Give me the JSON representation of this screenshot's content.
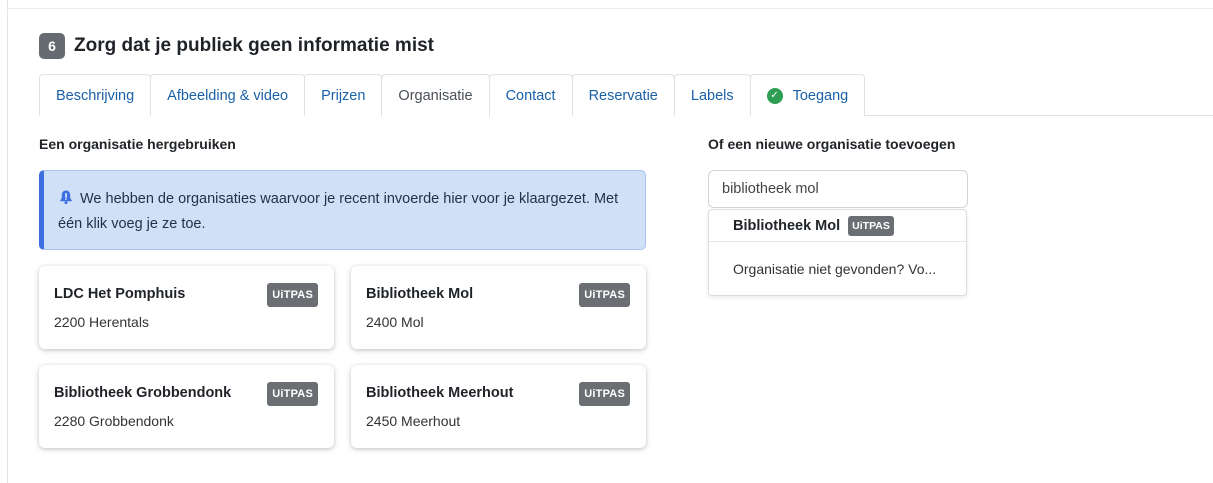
{
  "step": {
    "number": "6",
    "title": "Zorg dat je publiek geen informatie mist"
  },
  "tabs": [
    {
      "label": "Beschrijving"
    },
    {
      "label": "Afbeelding & video"
    },
    {
      "label": "Prijzen"
    },
    {
      "label": "Organisatie"
    },
    {
      "label": "Contact"
    },
    {
      "label": "Reservatie"
    },
    {
      "label": "Labels"
    },
    {
      "label": "Toegang"
    }
  ],
  "reuse": {
    "heading": "Een organisatie hergebruiken",
    "alert_text": "We hebben de organisaties waarvoor je recent invoerde hier voor je klaargezet. Met één klik voeg je ze toe.",
    "cards": [
      {
        "name": "LDC Het Pomphuis",
        "location": "2200 Herentals",
        "badge": "UiTPAS"
      },
      {
        "name": "Bibliotheek Mol",
        "location": "2400 Mol",
        "badge": "UiTPAS"
      },
      {
        "name": "Bibliotheek Grobbendonk",
        "location": "2280 Grobbendonk",
        "badge": "UiTPAS"
      },
      {
        "name": "Bibliotheek Meerhout",
        "location": "2450 Meerhout",
        "badge": "UiTPAS"
      }
    ]
  },
  "new_org": {
    "heading": "Of een nieuwe organisatie toevoegen",
    "search_value": "bibliotheek mol",
    "suggestions": [
      {
        "name": "Bibliotheek Mol",
        "badge": "UiTPAS"
      },
      {
        "text": "Organisatie niet gevonden? Vo..."
      }
    ]
  },
  "colors": {
    "accent_link": "#1a61a8",
    "alert_bg": "#cfe0f7",
    "success": "#2f9e55"
  }
}
